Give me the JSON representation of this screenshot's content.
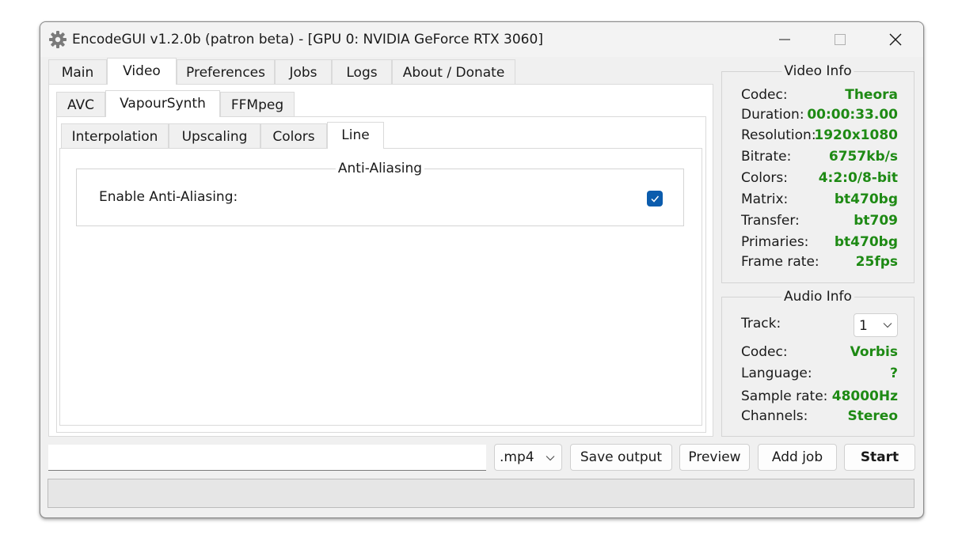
{
  "window": {
    "title": "EncodeGUI v1.2.0b (patron beta) - [GPU 0: NVIDIA GeForce RTX 3060]"
  },
  "main_tabs": [
    "Main",
    "Video",
    "Preferences",
    "Jobs",
    "Logs",
    "About / Donate"
  ],
  "main_tabs_active": "Video",
  "video_tabs": [
    "AVC",
    "VapourSynth",
    "FFMpeg"
  ],
  "video_tabs_active": "VapourSynth",
  "vs_tabs": [
    "Interpolation",
    "Upscaling",
    "Colors",
    "Line"
  ],
  "vs_tabs_active": "Line",
  "anti_aliasing": {
    "group_title": "Anti-Aliasing",
    "enable_label": "Enable Anti-Aliasing:",
    "enabled": true
  },
  "video_info": {
    "title": "Video Info",
    "rows": [
      {
        "label": "Codec:",
        "value": "Theora"
      },
      {
        "label": "Duration:",
        "value": "00:00:33.00"
      },
      {
        "label": "Resolution:",
        "value": "1920x1080"
      },
      {
        "label": "Bitrate:",
        "value": "6757kb/s"
      },
      {
        "label": "Colors:",
        "value": "4:2:0/8-bit"
      },
      {
        "label": "Matrix:",
        "value": "bt470bg"
      },
      {
        "label": "Transfer:",
        "value": "bt709"
      },
      {
        "label": "Primaries:",
        "value": "bt470bg"
      },
      {
        "label": "Frame rate:",
        "value": "25fps"
      }
    ]
  },
  "audio_info": {
    "title": "Audio Info",
    "track_label": "Track:",
    "track_value": "1",
    "rows": [
      {
        "label": "Codec:",
        "value": "Vorbis"
      },
      {
        "label": "Language:",
        "value": "?"
      },
      {
        "label": "Sample rate:",
        "value": "48000Hz"
      },
      {
        "label": "Channels:",
        "value": "Stereo"
      }
    ]
  },
  "bottom": {
    "output_path": "",
    "container": ".mp4",
    "save_output": "Save output",
    "preview": "Preview",
    "add_job": "Add job",
    "start": "Start",
    "progress": 0
  },
  "colors": {
    "value_green": "#1e8a14",
    "checkbox_blue": "#0b5cad"
  }
}
